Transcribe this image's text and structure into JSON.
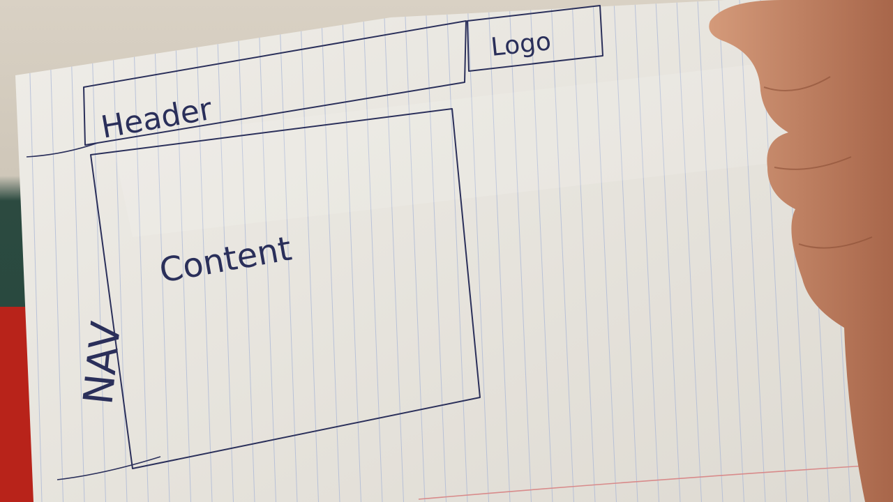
{
  "sketch": {
    "header_label": "Header",
    "logo_label": "Logo",
    "content_label": "Content",
    "nav_label": "NAV"
  },
  "colors": {
    "paper": "#eceae4",
    "ink": "#2a2f5a",
    "grid_line": "#a9b6d6",
    "margin_line": "#d88a8a",
    "skin": "#c88a6a",
    "shirt": "#b8231a"
  }
}
